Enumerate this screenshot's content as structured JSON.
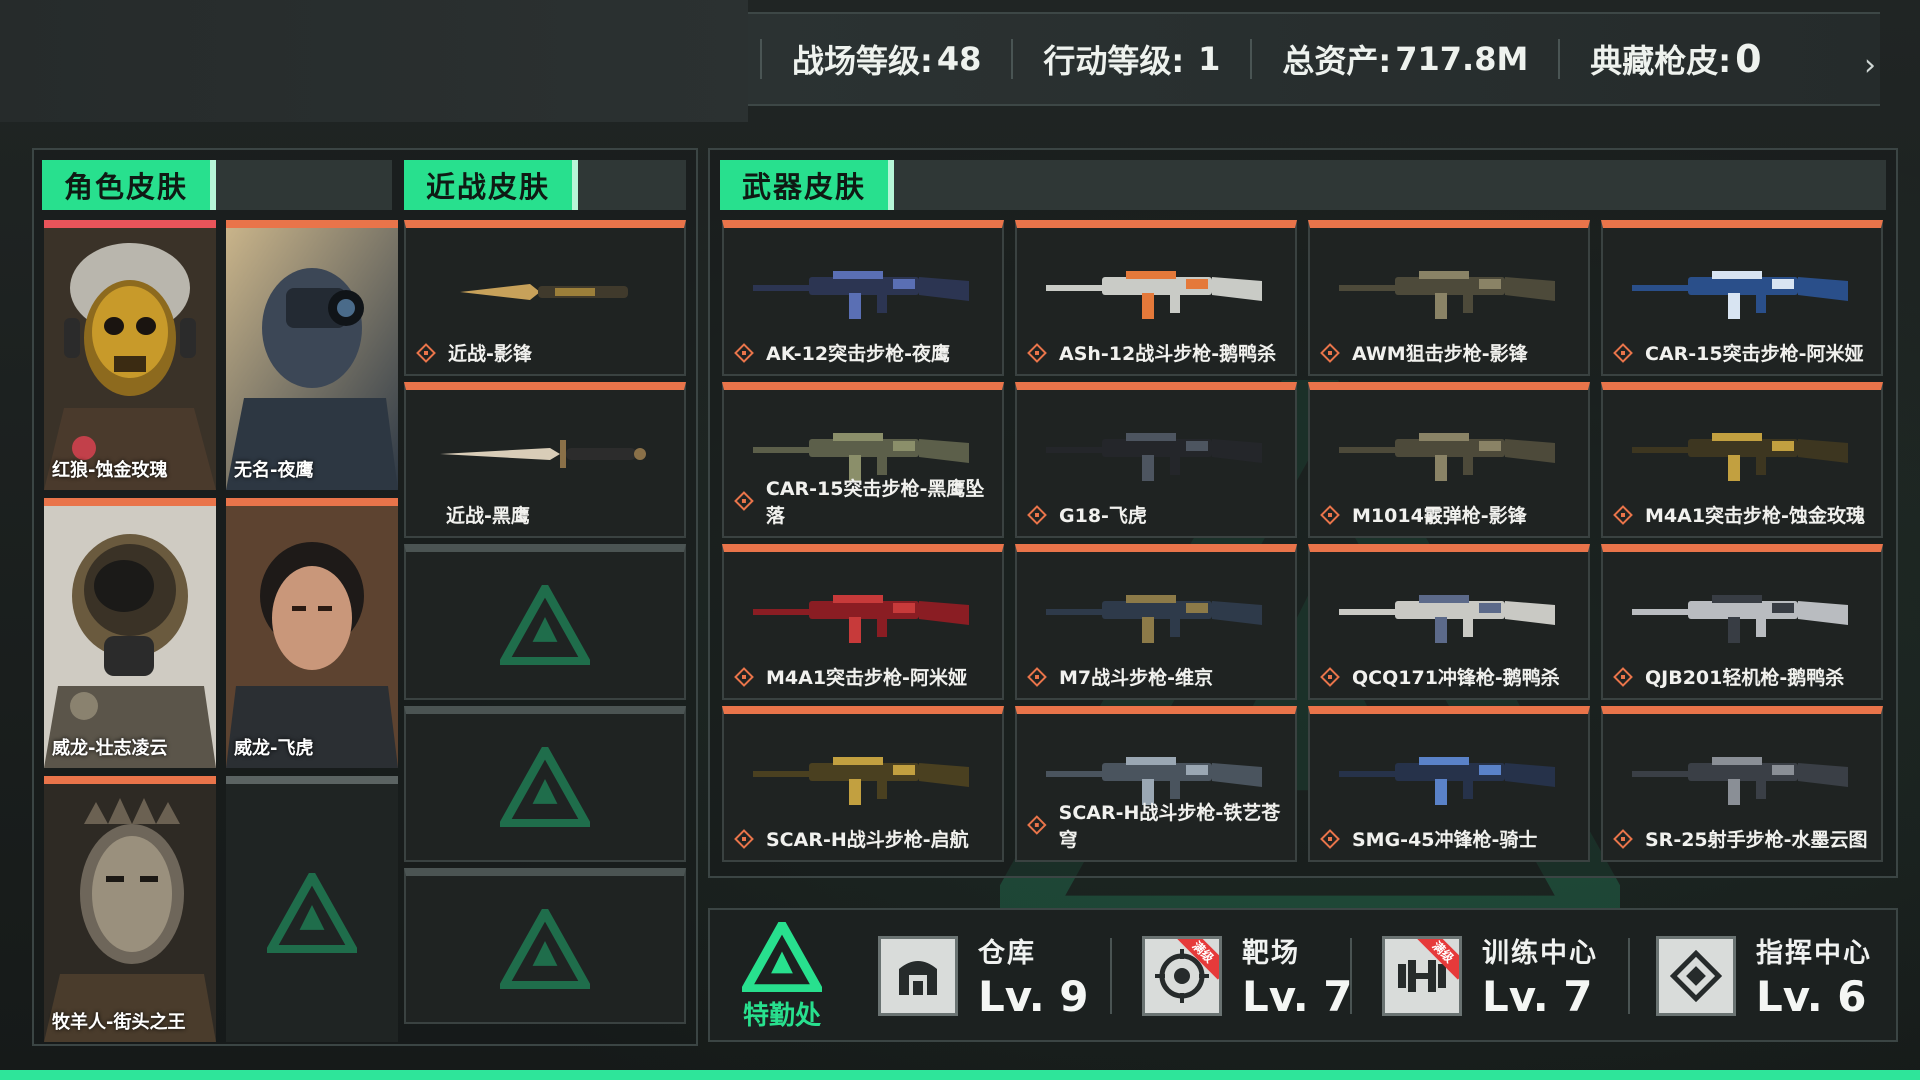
{
  "header": {
    "stats": [
      {
        "label": "战场等级:",
        "value": "48"
      },
      {
        "label": "行动等级:",
        "value": "1"
      },
      {
        "label": "总资产:",
        "value": "717.8M"
      },
      {
        "label": "典藏枪皮:",
        "value": "0"
      }
    ],
    "arrow": "›"
  },
  "sections": {
    "character": "角色皮肤",
    "melee": "近战皮肤",
    "weapon": "武器皮肤"
  },
  "characters": [
    {
      "name": "红狼-蚀金玫瑰"
    },
    {
      "name": "无名-夜鹰"
    },
    {
      "name": "威龙-壮志凌云"
    },
    {
      "name": "威龙-飞虎"
    },
    {
      "name": "牧羊人-街头之王"
    }
  ],
  "melee": [
    {
      "name": "近战-影锋"
    },
    {
      "name": "近战-黑鹰"
    }
  ],
  "weapons": [
    {
      "name": "AK-12突击步枪-夜鹰"
    },
    {
      "name": "ASh-12战斗步枪-鹅鸭杀"
    },
    {
      "name": "AWM狙击步枪-影锋"
    },
    {
      "name": "CAR-15突击步枪-阿米娅"
    },
    {
      "name": "CAR-15突击步枪-黑鹰坠落"
    },
    {
      "name": "G18-飞虎"
    },
    {
      "name": "M1014霰弹枪-影锋"
    },
    {
      "name": "M4A1突击步枪-蚀金玫瑰"
    },
    {
      "name": "M4A1突击步枪-阿米娅"
    },
    {
      "name": "M7战斗步枪-维京"
    },
    {
      "name": "QCQ171冲锋枪-鹅鸭杀"
    },
    {
      "name": "QJB201轻机枪-鹅鸭杀"
    },
    {
      "name": "SCAR-H战斗步枪-启航"
    },
    {
      "name": "SCAR-H战斗步枪-铁艺苍穹"
    },
    {
      "name": "SMG-45冲锋枪-骑士"
    },
    {
      "name": "SR-25射手步枪-水墨云图"
    }
  ],
  "logistics": {
    "title": "特勤处"
  },
  "facilities": [
    {
      "name": "仓库",
      "level": "Lv. 9",
      "icon": "warehouse-icon"
    },
    {
      "name": "靶场",
      "level": "Lv. 7",
      "icon": "target-icon",
      "badge": "满级"
    },
    {
      "name": "训练中心",
      "level": "Lv. 7",
      "icon": "dumbbell-icon",
      "badge": "满级"
    },
    {
      "name": "指挥中心",
      "level": "Lv. 6",
      "icon": "command-icon"
    }
  ],
  "colors": {
    "accent": "#28e08e",
    "rarity_orange": "#e9744a",
    "panel_bg": "#1f2322"
  }
}
